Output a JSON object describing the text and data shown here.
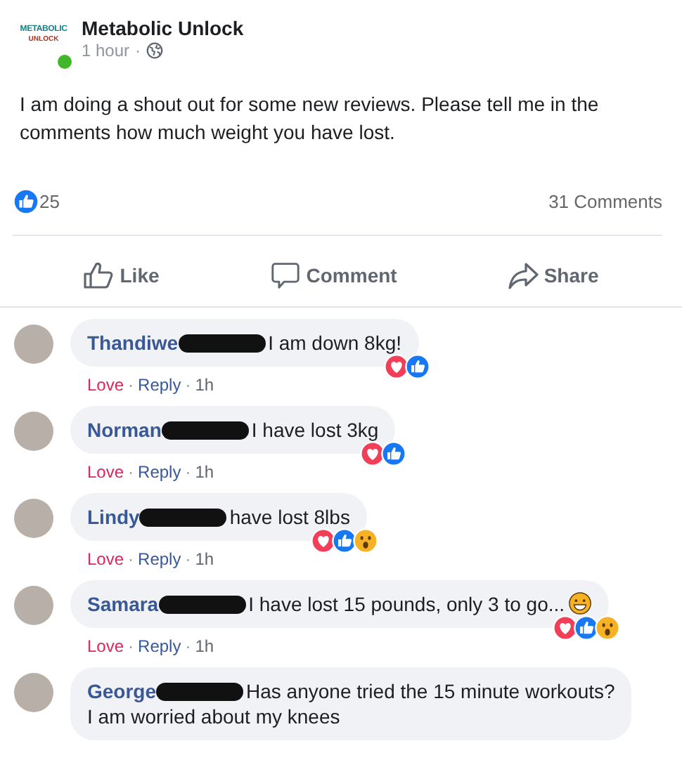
{
  "post": {
    "author": "Metabolic Unlock",
    "logo_lines": [
      "METABOLIC",
      "UNLOCK"
    ],
    "online": true,
    "time": "1 hour",
    "separator": "·",
    "text": "I am doing a shout out for some new reviews. Please tell me in the comments how much weight you have lost."
  },
  "stats": {
    "reaction_count": "25",
    "comments": "31 Comments"
  },
  "actions": [
    {
      "kind": "like",
      "label": "Like"
    },
    {
      "kind": "comment",
      "label": "Comment"
    },
    {
      "kind": "share",
      "label": "Share"
    }
  ],
  "comments": [
    {
      "name": "Thandiwe",
      "redacted": true,
      "text": [
        "I am down 8kg!"
      ],
      "reactions": [
        {
          "kind": "love"
        },
        {
          "kind": "like"
        }
      ],
      "links": [
        {
          "kind": "love",
          "label": "Love",
          "reacted": true
        },
        {
          "kind": "separator",
          "label": "·"
        },
        {
          "kind": "reply",
          "label": "Reply"
        },
        {
          "kind": "separator",
          "label": "·"
        },
        {
          "kind": "time",
          "label": "1h"
        }
      ]
    },
    {
      "name": "Norman",
      "redacted": true,
      "text": [
        "I have lost 3kg"
      ],
      "reactions": [
        {
          "kind": "love"
        },
        {
          "kind": "like"
        }
      ],
      "links": [
        {
          "kind": "love",
          "label": "Love",
          "reacted": true
        },
        {
          "kind": "separator",
          "label": "·"
        },
        {
          "kind": "reply",
          "label": "Reply"
        },
        {
          "kind": "separator",
          "label": "·"
        },
        {
          "kind": "time",
          "label": "1h"
        }
      ]
    },
    {
      "name": "Lindy",
      "redacted": true,
      "text": [
        "have lost 8lbs"
      ],
      "reactions": [
        {
          "kind": "love"
        },
        {
          "kind": "like"
        },
        {
          "kind": "wow"
        }
      ],
      "links": [
        {
          "kind": "love",
          "label": "Love",
          "reacted": true
        },
        {
          "kind": "separator",
          "label": "·"
        },
        {
          "kind": "reply",
          "label": "Reply"
        },
        {
          "kind": "separator",
          "label": "·"
        },
        {
          "kind": "time",
          "label": "1h"
        }
      ]
    },
    {
      "name": "Samara",
      "redacted": true,
      "text": [
        "I have lost 15 pounds, only 3 to go..."
      ],
      "emoji": true,
      "reactions": [
        {
          "kind": "love"
        },
        {
          "kind": "like"
        },
        {
          "kind": "wow"
        }
      ],
      "links": [
        {
          "kind": "love",
          "label": "Love",
          "reacted": true
        },
        {
          "kind": "separator",
          "label": "·"
        },
        {
          "kind": "reply",
          "label": "Reply"
        },
        {
          "kind": "separator",
          "label": "·"
        },
        {
          "kind": "time",
          "label": "1h"
        }
      ]
    },
    {
      "name": "George",
      "redacted": true,
      "text": [
        "Has anyone tried the 15 minute workouts?",
        "I am worried about my knees"
      ]
    }
  ]
}
